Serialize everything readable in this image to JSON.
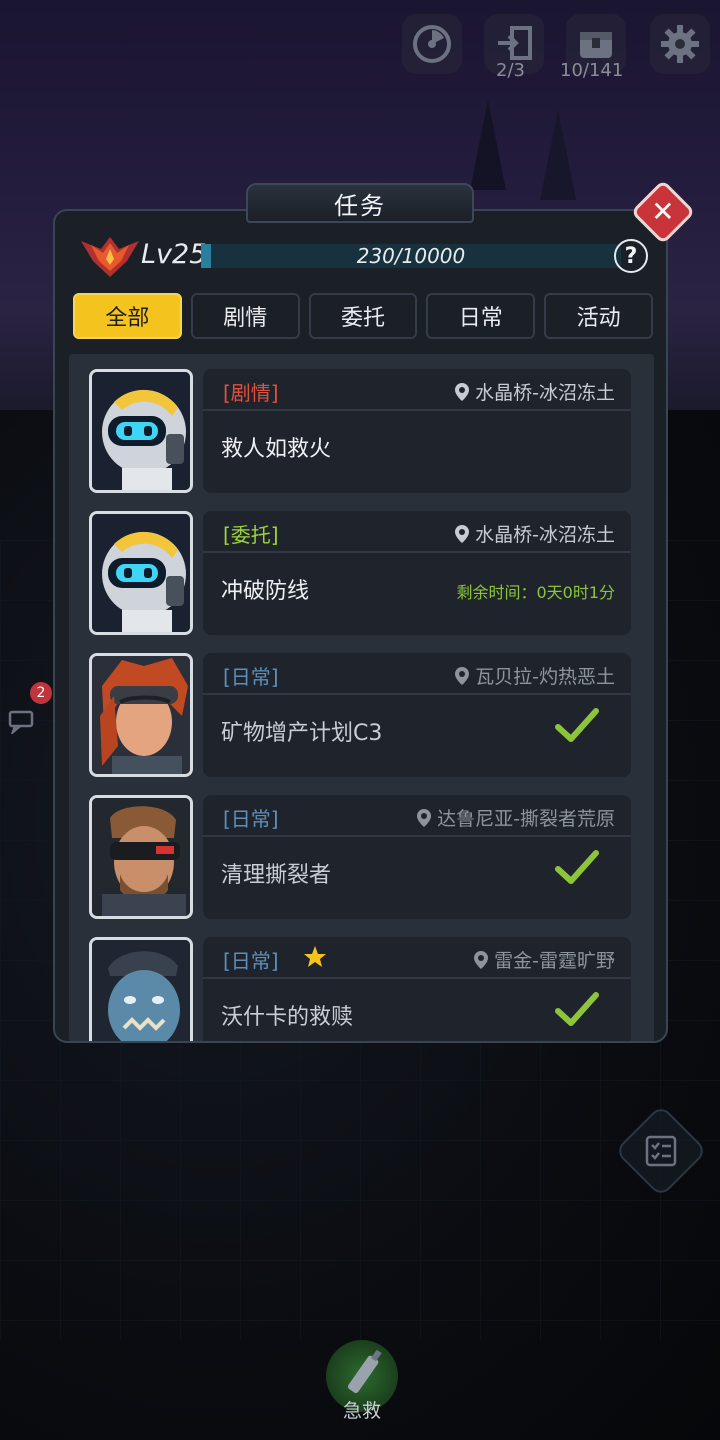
{
  "hud": {
    "portal_count": "2/3",
    "chest_count": "10/141"
  },
  "panel": {
    "title": "任务",
    "level_label": "Lv25",
    "exp_text": "230/10000",
    "exp_progress": 0.023,
    "help_label": "?",
    "close_label": "✕"
  },
  "tabs": [
    {
      "label": "全部",
      "active": true
    },
    {
      "label": "剧情",
      "active": false
    },
    {
      "label": "委托",
      "active": false
    },
    {
      "label": "日常",
      "active": false
    },
    {
      "label": "活动",
      "active": false
    }
  ],
  "quests": [
    {
      "tag": "[剧情]",
      "type": "story",
      "location": "水晶桥-冰沼冻土",
      "name": "救人如救火",
      "status": "",
      "completed": false,
      "starred": false,
      "portrait": "robot"
    },
    {
      "tag": "[委托]",
      "type": "entrust",
      "location": "水晶桥-冰沼冻土",
      "name": "冲破防线",
      "status": "剩余时间：0天0时1分",
      "completed": false,
      "starred": false,
      "portrait": "robot"
    },
    {
      "tag": "[日常]",
      "type": "daily",
      "location": "瓦贝拉-灼热恶土",
      "name": "矿物增产计划C3",
      "status": "",
      "completed": true,
      "starred": false,
      "portrait": "red-hair-woman"
    },
    {
      "tag": "[日常]",
      "type": "daily",
      "location": "达鲁尼亚-撕裂者荒原",
      "name": "清理撕裂者",
      "status": "",
      "completed": true,
      "starred": false,
      "portrait": "goggles-man"
    },
    {
      "tag": "[日常]",
      "type": "daily",
      "location": "雷金-雷霆旷野",
      "name": "沃什卡的救赎",
      "status": "",
      "completed": true,
      "starred": true,
      "portrait": "blue-orc"
    }
  ],
  "side": {
    "badge_count": "2"
  },
  "bottom": {
    "rescue_label": "急救"
  },
  "colors": {
    "accent": "#f4c31d",
    "story_tag": "#e0503c",
    "entrust_tag": "#9bd33e",
    "daily_tag": "#5d8fb8",
    "check": "#8cc53a",
    "close": "#c8343a"
  }
}
